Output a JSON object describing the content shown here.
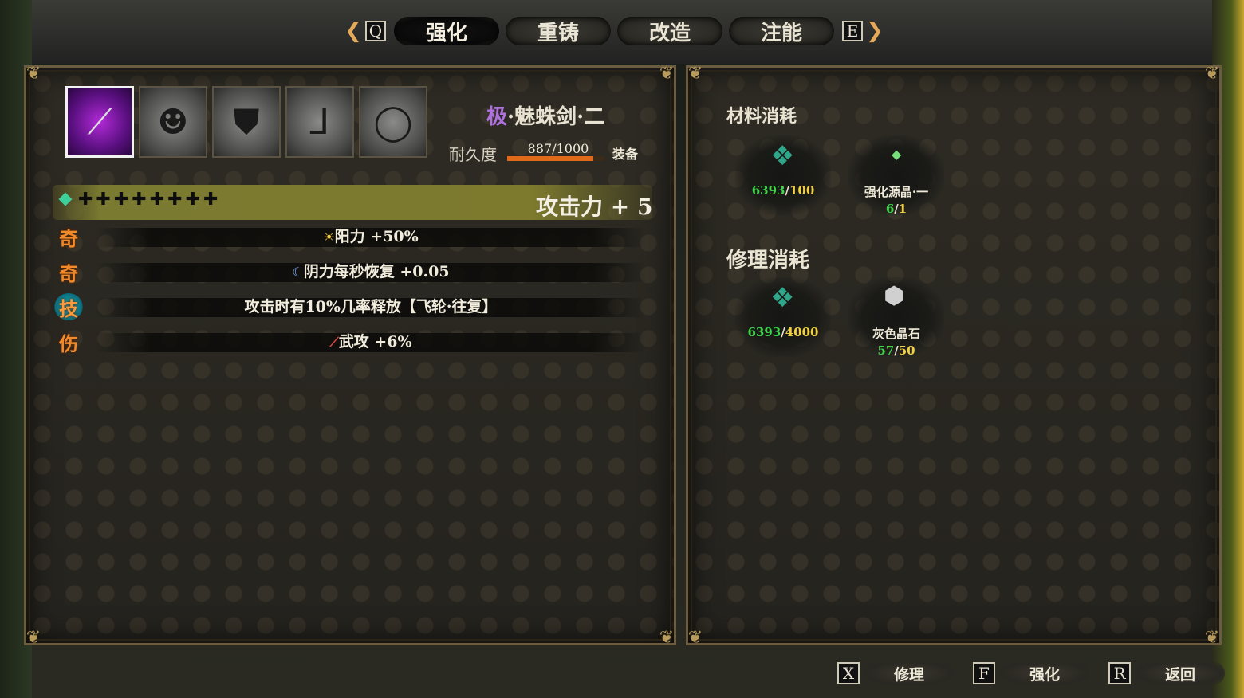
{
  "tabs": {
    "prev_key": "Q",
    "next_key": "E",
    "items": [
      "强化",
      "重铸",
      "改造",
      "注能"
    ],
    "active": "强化"
  },
  "equipment": {
    "slots": [
      "sword-icon",
      "mask-icon",
      "chest-armor-icon",
      "boots-icon",
      "ring-icon"
    ],
    "selected_index": 0
  },
  "item": {
    "rarity": "极",
    "name": "·魅蛛剑·二",
    "durability_label": "耐久度",
    "durability_text": "887/1000",
    "durability_fraction": 0.887,
    "equipped_label": "装备"
  },
  "attack": {
    "upgrade_marks": "✚✚✚✚✚✚✚✚",
    "text": "攻击力 + 5"
  },
  "stats": [
    {
      "icon": "奇",
      "kind": "odd",
      "symbol": "☀",
      "symbol_name": "sun-icon",
      "text": "阳力 +50%"
    },
    {
      "icon": "奇",
      "kind": "odd",
      "symbol": "☾",
      "symbol_name": "moon-icon",
      "text": "阴力每秒恢复 +0.05"
    },
    {
      "icon": "技",
      "kind": "skill",
      "symbol": "",
      "symbol_name": "",
      "text": "攻击时有10%几率释放【飞轮·往复】"
    },
    {
      "icon": "伤",
      "kind": "dmg",
      "symbol": "🗡",
      "symbol_name": "dagger-icon",
      "text": "武攻 +6%"
    }
  ],
  "materials": {
    "title": "材料消耗",
    "items": [
      {
        "icon": "teal-crystal-icon",
        "name": "",
        "have": "6393",
        "need": "100"
      },
      {
        "icon": "green-shard-icon",
        "name": "强化源晶·一",
        "have": "6",
        "need": "1"
      }
    ]
  },
  "repair": {
    "title": "修理消耗",
    "items": [
      {
        "icon": "teal-crystal-icon",
        "name": "",
        "have": "6393",
        "need": "4000"
      },
      {
        "icon": "grey-crystal-icon",
        "name": "灰色晶石",
        "have": "57",
        "need": "50"
      }
    ]
  },
  "actions": [
    {
      "key": "X",
      "label": "修理"
    },
    {
      "key": "F",
      "label": "强化"
    },
    {
      "key": "R",
      "label": "返回"
    }
  ]
}
